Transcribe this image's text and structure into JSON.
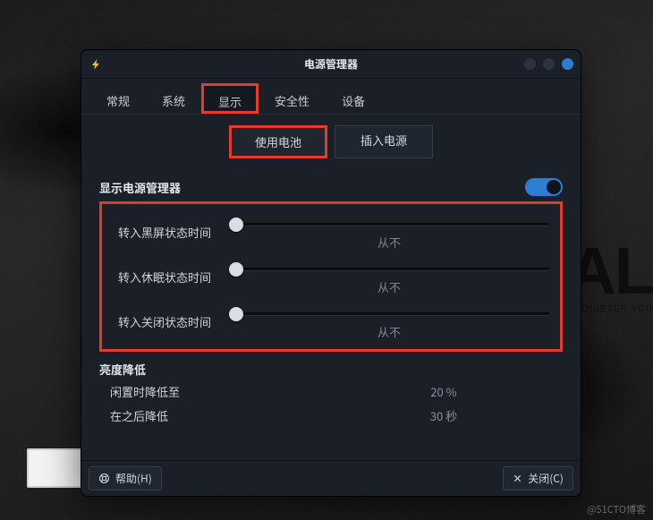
{
  "window": {
    "title": "电源管理器"
  },
  "tabs": [
    "常规",
    "系统",
    "显示",
    "安全性",
    "设备"
  ],
  "active_tab_index": 2,
  "subtabs": [
    "使用电池",
    "插入电源"
  ],
  "active_subtab_index": 0,
  "sections": {
    "dpm": {
      "heading": "显示电源管理器",
      "toggle_on": true,
      "rows": [
        {
          "label": "转入黑屏状态时间",
          "value": "从不"
        },
        {
          "label": "转入休眠状态时间",
          "value": "从不"
        },
        {
          "label": "转入关闭状态时间",
          "value": "从不"
        }
      ]
    },
    "brightness": {
      "heading": "亮度降低",
      "rows": [
        {
          "label": "闲置时降低至",
          "value": "20 %"
        },
        {
          "label": "在之后降低",
          "value": "30 秒"
        }
      ]
    }
  },
  "footer": {
    "help": "帮助(H)",
    "close": "关闭(C)"
  },
  "highlight_color": "#e33b2e",
  "accent_color": "#2d7dd2",
  "watermark": "@51CTO博客"
}
